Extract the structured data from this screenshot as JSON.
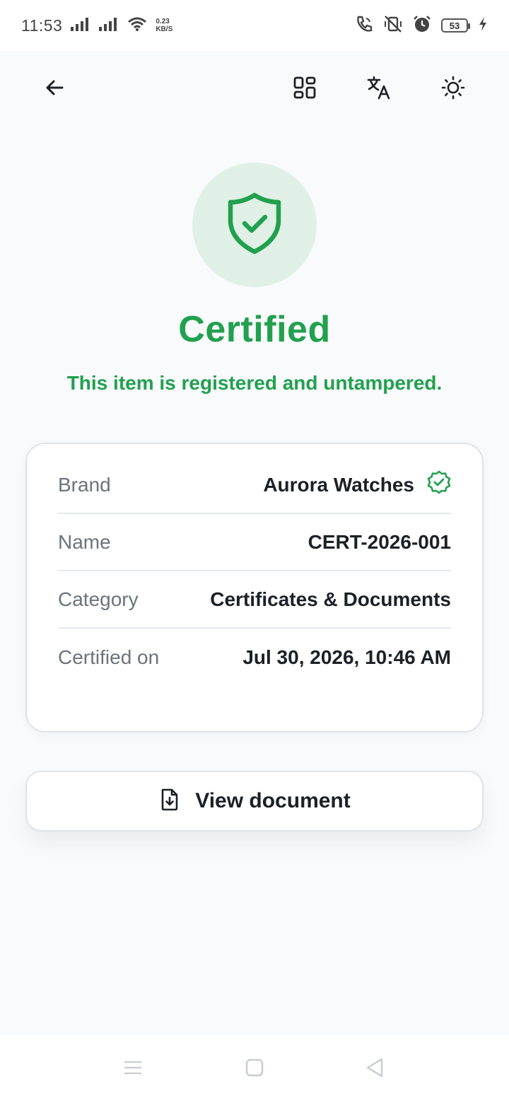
{
  "status_bar": {
    "time": "11:53",
    "net_speed_value": "0.23",
    "net_speed_unit": "KB/S",
    "battery": "53"
  },
  "app_bar": {
    "icons": [
      "back-arrow-icon",
      "qr-code-icon",
      "translate-icon",
      "brightness-icon"
    ]
  },
  "hero": {
    "icon": "shield-check-icon",
    "title": "Certified",
    "subtitle": "This item is registered and untampered."
  },
  "details": {
    "rows": [
      {
        "label": "Brand",
        "value": "Aurora Watches",
        "verified_badge": true
      },
      {
        "label": "Name",
        "value": "CERT-2026-001"
      },
      {
        "label": "Category",
        "value": "Certificates & Documents"
      },
      {
        "label": "Certified on",
        "value": "Jul 30, 2026, 10:46 AM"
      }
    ]
  },
  "actions": {
    "view_document_label": "View document",
    "view_document_icon": "file-download-icon"
  },
  "colors": {
    "accent_green": "#21a04e",
    "hero_circle_bg": "#e0f0e6",
    "page_bg": "#f8fafc"
  }
}
